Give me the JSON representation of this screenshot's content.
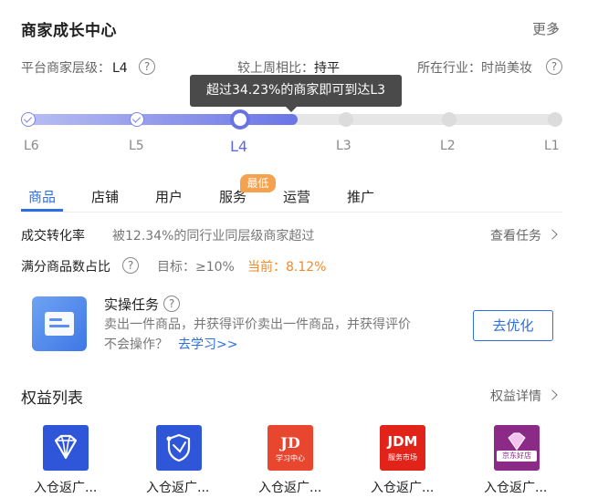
{
  "header": {
    "title": "商家成长中心",
    "more_label": "更多"
  },
  "info": {
    "level_label": "平台商家层级：",
    "level_value": "L4",
    "compare_label": "较上周相比：",
    "compare_value": "持平",
    "industry_label": "所在行业：",
    "industry_value": "时尚美妆"
  },
  "progress": {
    "tooltip": "超过34.23%的商家即可到达L3",
    "levels": [
      "L6",
      "L5",
      "L4",
      "L3",
      "L2",
      "L1"
    ],
    "current_level": "L4",
    "accent_color": "#6a73e4"
  },
  "tabs": {
    "items": [
      "商品",
      "店铺",
      "用户",
      "服务",
      "运营",
      "推广"
    ],
    "active": "商品",
    "badge": "最低"
  },
  "metrics": {
    "conversion_label": "成交转化率",
    "conversion_desc": "被12.34%的同行业同层级商家超过",
    "view_task_label": "查看任务",
    "full_score_label": "满分商品数占比",
    "target_label": "目标：",
    "target_value": "≥10%",
    "current_label": "当前：",
    "current_value": "8.12%"
  },
  "task": {
    "title": "实操任务",
    "desc": "卖出一件商品，并获得评价卖出一件商品，并获得评价",
    "desc2": "不会操作？",
    "learn_link": "去学习>>",
    "button": "去优化"
  },
  "benefits": {
    "title": "权益列表",
    "detail_label": "权益详情",
    "items": [
      {
        "icon": "diamond-icon",
        "label": "入仓返广..."
      },
      {
        "icon": "shield-icon",
        "label": "入仓返广..."
      },
      {
        "icon": "jd-learning-center-icon",
        "label": "入仓返广...",
        "logo_text": "JD",
        "logo_sub": "学习中心"
      },
      {
        "icon": "jdm-service-market-icon",
        "label": "入仓返广...",
        "logo_text": "JDM",
        "logo_sub": "服务市场"
      },
      {
        "icon": "jd-good-store-icon",
        "label": "入仓返广...",
        "logo_text": "京东好店"
      }
    ]
  }
}
